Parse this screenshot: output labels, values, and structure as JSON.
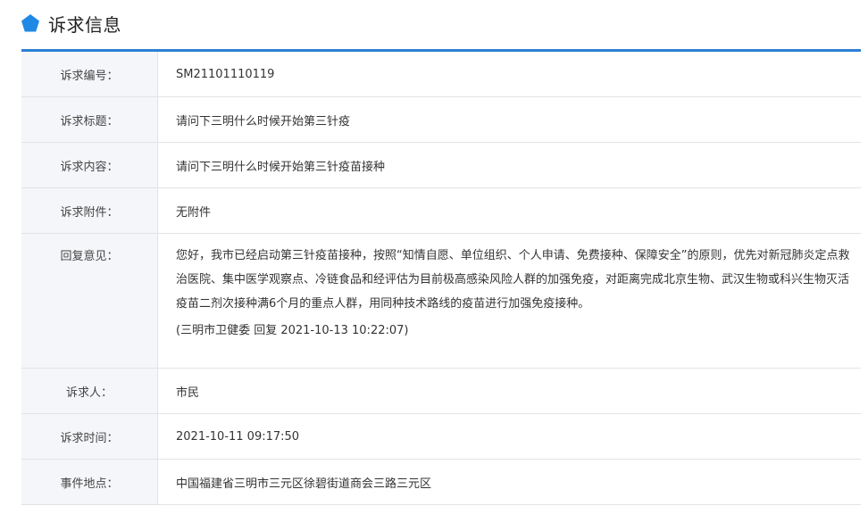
{
  "section": {
    "title": "诉求信息",
    "icon": "pentagon-icon",
    "icon_color": "#1e88e5",
    "accent_color": "#2b7fd3"
  },
  "fields": {
    "id_label": "诉求编号：",
    "id_value": "SM21101110119",
    "subject_label": "诉求标题：",
    "subject_value": "请问下三明什么时候开始第三针疫",
    "content_label": "诉求内容：",
    "content_value": "请问下三明什么时候开始第三针疫苗接种",
    "attachment_label": "诉求附件：",
    "attachment_value": "无附件",
    "reply_label": "回复意见：",
    "reply_text": "您好，我市已经启动第三针疫苗接种，按照“知情自愿、单位组织、个人申请、免费接种、保障安全”的原则，优先对新冠肺炎定点救治医院、集中医学观察点、冷链食品和经评估为目前极高感染风险人群的加强免疫，对距离完成北京生物、武汉生物或科兴生物灭活疫苗二剂次接种满6个月的重点人群，用同种技术路线的疫苗进行加强免疫接种。",
    "reply_meta": "(三明市卫健委 回复 2021-10-13 10:22:07)",
    "person_label": "诉求人：",
    "person_value": "市民",
    "time_label": "诉求时间：",
    "time_value": "2021-10-11 09:17:50",
    "location_label": "事件地点：",
    "location_value": "中国福建省三明市三元区徐碧街道商会三路三元区"
  }
}
